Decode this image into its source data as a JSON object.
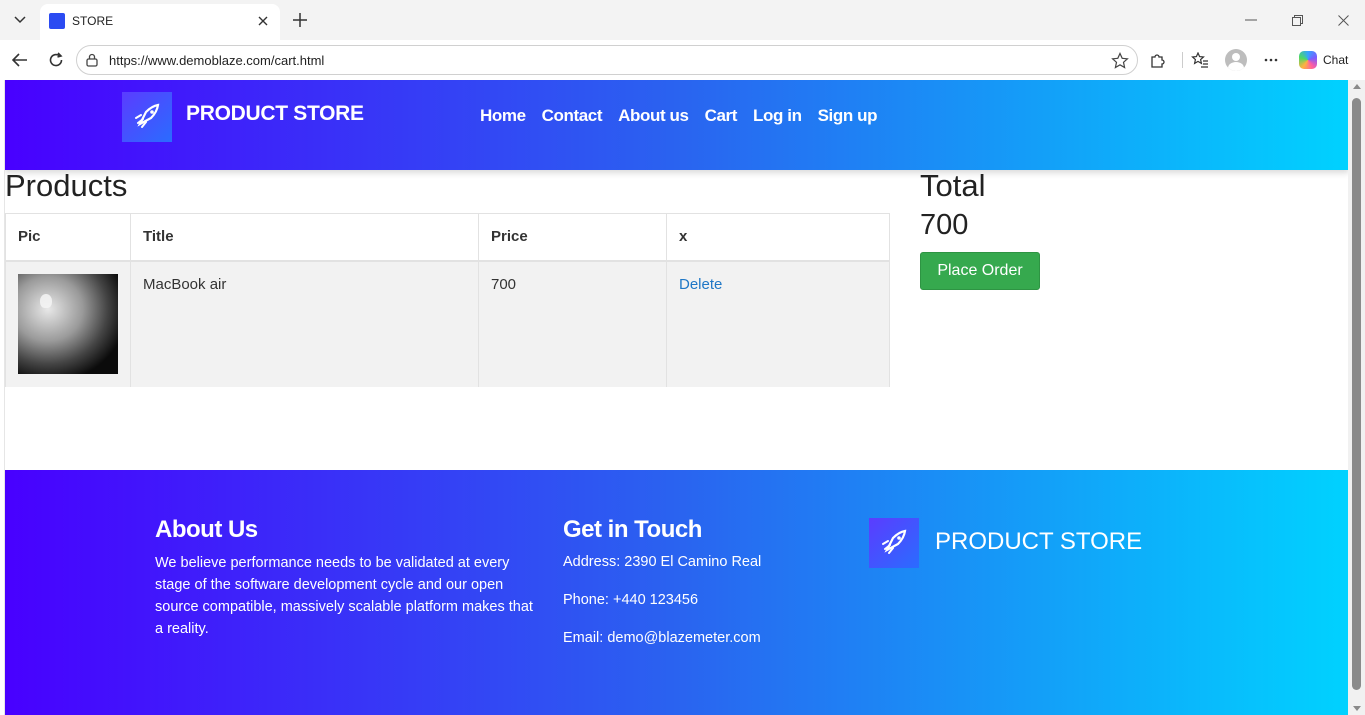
{
  "browser": {
    "tab_title": "STORE",
    "url": "https://www.demoblaze.com/cart.html",
    "chat_label": "Chat"
  },
  "header": {
    "brand": "PRODUCT STORE",
    "nav": [
      "Home",
      "Contact",
      "About us",
      "Cart",
      "Log in",
      "Sign up"
    ]
  },
  "cart": {
    "heading": "Products",
    "columns": [
      "Pic",
      "Title",
      "Price",
      "x"
    ],
    "rows": [
      {
        "title": "MacBook air",
        "price": "700",
        "action": "Delete"
      }
    ]
  },
  "summary": {
    "heading": "Total",
    "total": "700",
    "button": "Place Order"
  },
  "footer": {
    "about_heading": "About Us",
    "about_text": "We believe performance needs to be validated at every stage of the software development cycle and our open source compatible, massively scalable platform makes that a reality.",
    "contact_heading": "Get in Touch",
    "address": "Address: 2390 El Camino Real",
    "phone": "Phone: +440 123456",
    "email": "Email: demo@blazemeter.com",
    "brand": "PRODUCT STORE"
  },
  "colors": {
    "gradient_start": "#4800ff",
    "gradient_end": "#00d2ff",
    "button_green": "#36a94e",
    "link_blue": "#1f77c6"
  }
}
